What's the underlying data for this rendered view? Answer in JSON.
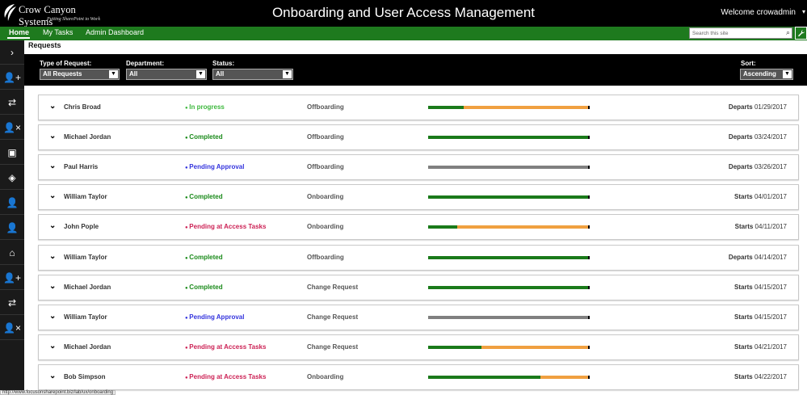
{
  "header": {
    "logo_name": "Crow Canyon Systems",
    "logo_tagline": "Putting SharePoint to Work",
    "title": "Onboarding and User Access Management",
    "welcome": "Welcome crowadmin"
  },
  "nav": {
    "home": "Home",
    "my_tasks": "My Tasks",
    "admin_dashboard": "Admin Dashboard",
    "search_placeholder": "Search this site"
  },
  "sidebar": {
    "icons": [
      "expand-icon",
      "add-user-icon",
      "transfer-icon",
      "remove-user-icon",
      "save-icon",
      "tag-icon",
      "user-tie-icon",
      "user-icon",
      "home-icon",
      "add-user-icon",
      "transfer-icon",
      "remove-user-icon"
    ]
  },
  "page": {
    "section_title": "Requests"
  },
  "filters": {
    "type_label": "Type of Request:",
    "type_value": "All Requests",
    "department_label": "Department:",
    "department_value": "All",
    "status_label": "Status:",
    "status_value": "All",
    "sort_label": "Sort:",
    "sort_value": "Ascending"
  },
  "colors": {
    "in_progress": "#3cb83c",
    "completed": "#1a8a1a",
    "pending_approval": "#3333dd",
    "pending_access": "#cc2255",
    "bar_green": "#1a7a1a",
    "bar_orange": "#f0a040",
    "bar_gray": "#808080"
  },
  "requests": [
    {
      "name": "Chris Broad",
      "status": "In progress",
      "status_key": "in_progress",
      "type": "Offboarding",
      "date_label": "Departs",
      "date": "01/29/2017",
      "progress": 0.22,
      "pending": false
    },
    {
      "name": "Michael Jordan",
      "status": "Completed",
      "status_key": "completed",
      "type": "Offboarding",
      "date_label": "Departs",
      "date": "03/24/2017",
      "progress": 1.0,
      "pending": false
    },
    {
      "name": "Paul Harris",
      "status": "Pending Approval",
      "status_key": "pending_approval",
      "type": "Offboarding",
      "date_label": "Departs",
      "date": "03/26/2017",
      "progress": 0.0,
      "pending": true
    },
    {
      "name": "William Taylor",
      "status": "Completed",
      "status_key": "completed",
      "type": "Onboarding",
      "date_label": "Starts",
      "date": "04/01/2017",
      "progress": 1.0,
      "pending": false
    },
    {
      "name": "John Pople",
      "status": "Pending at Access Tasks",
      "status_key": "pending_access",
      "type": "Onboarding",
      "date_label": "Starts",
      "date": "04/11/2017",
      "progress": 0.18,
      "pending": false
    },
    {
      "name": "William Taylor",
      "status": "Completed",
      "status_key": "completed",
      "type": "Offboarding",
      "date_label": "Departs",
      "date": "04/14/2017",
      "progress": 1.0,
      "pending": false
    },
    {
      "name": "Michael Jordan",
      "status": "Completed",
      "status_key": "completed",
      "type": "Change Request",
      "date_label": "Starts",
      "date": "04/15/2017",
      "progress": 1.0,
      "pending": false
    },
    {
      "name": "William Taylor",
      "status": "Pending Approval",
      "status_key": "pending_approval",
      "type": "Change Request",
      "date_label": "Starts",
      "date": "04/15/2017",
      "progress": 0.0,
      "pending": true
    },
    {
      "name": "Michael Jordan",
      "status": "Pending at Access Tasks",
      "status_key": "pending_access",
      "type": "Change Request",
      "date_label": "Starts",
      "date": "04/21/2017",
      "progress": 0.33,
      "pending": false
    },
    {
      "name": "Bob Simpson",
      "status": "Pending at Access Tasks",
      "status_key": "pending_access",
      "type": "Onboarding",
      "date_label": "Starts",
      "date": "04/22/2017",
      "progress": 0.7,
      "pending": false
    }
  ],
  "statusbar": {
    "url": "http://www.focusonsharepoint.biz/lab/ux/onboarding"
  }
}
